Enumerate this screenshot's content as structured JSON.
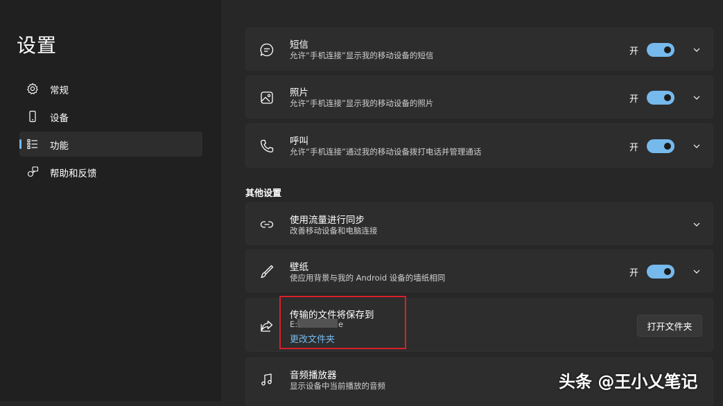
{
  "sidebar": {
    "title": "设置",
    "items": [
      {
        "label": "常规",
        "icon": "gear-icon"
      },
      {
        "label": "设备",
        "icon": "phone-icon"
      },
      {
        "label": "功能",
        "icon": "feature-list-icon",
        "selected": true
      },
      {
        "label": "帮助和反馈",
        "icon": "help-feedback-icon"
      }
    ]
  },
  "main": {
    "cards": [
      {
        "title": "短信",
        "subtitle": "允许“手机连接”显示我的移动设备的短信",
        "state": "开",
        "toggle_on": true,
        "icon": "message-icon"
      },
      {
        "title": "照片",
        "subtitle": "允许“手机连接”显示我的移动设备的照片",
        "state": "开",
        "toggle_on": true,
        "icon": "photo-icon"
      },
      {
        "title": "呼叫",
        "subtitle": "允许“手机连接”通过我的移动设备拨打电话并管理通话",
        "state": "开",
        "toggle_on": true,
        "icon": "phone-call-icon"
      }
    ],
    "other_section_label": "其他设置",
    "other_cards": [
      {
        "title": "使用流量进行同步",
        "subtitle": "改善移动设备和电脑连接",
        "icon": "link-icon"
      },
      {
        "title": "壁纸",
        "subtitle": "使应用背景与我的 Android 设备的墙纸相同",
        "state": "开",
        "toggle_on": true,
        "icon": "brush-icon"
      },
      {
        "title": "传输的文件将保存到",
        "path_prefix": "E:\\",
        "path_suffix": "e",
        "link": "更改文件夹",
        "button": "打开文件夹",
        "icon": "share-icon"
      },
      {
        "title": "音频播放器",
        "subtitle": "显示设备中当前播放的音频",
        "icon": "music-icon"
      }
    ]
  },
  "watermark": "头条 @王小乂笔记",
  "colors": {
    "accent": "#76b9ed",
    "highlight": "#d9202a",
    "background": "#272727",
    "sidebar": "#202020",
    "card": "#2d2d2d"
  }
}
